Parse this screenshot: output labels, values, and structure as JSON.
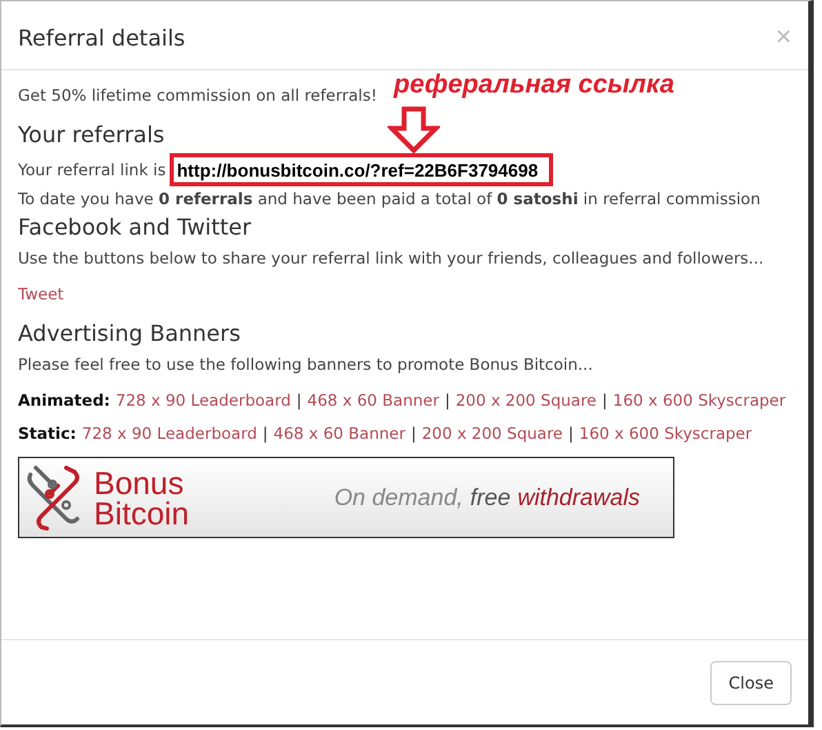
{
  "modal": {
    "title": "Referral details",
    "close_icon": "×"
  },
  "intro": "Get 50% lifetime commission on all referrals!",
  "annotation": {
    "caption": "реферальная ссылка"
  },
  "referrals": {
    "heading": "Your referrals",
    "link_label": "Your referral link is",
    "link": "http://bonusbitcoin.co/?ref=22B6F3794698",
    "summary": "To date you have **0 referrals** and have been paid a total of **0 satoshi** in referral commission"
  },
  "social": {
    "heading": "Facebook and Twitter",
    "text": "Use the buttons below to share your referral link with your friends, colleagues and followers...",
    "tweet": "Tweet"
  },
  "banners": {
    "heading": "Advertising Banners",
    "text": "Please feel free to use the following banners to promote Bonus Bitcoin...",
    "rows": [
      {
        "label": "Animated:",
        "links": [
          "728 x 90 Leaderboard",
          "468 x 60 Banner",
          "200 x 200 Square",
          "160 x 600 Skyscraper"
        ],
        "separator": "|"
      },
      {
        "label": "Static:",
        "links": [
          "728 x 90 Leaderboard",
          "468 x 60 Banner",
          "200 x 200 Square",
          "160 x 600 Skyscraper"
        ],
        "separator": "|"
      }
    ],
    "banner": {
      "brand": [
        "Bonus",
        "Bitcoin"
      ],
      "tagline": [
        {
          "text": "On demand,",
          "kind": "muted"
        },
        {
          "text": "free",
          "kind": "strong"
        },
        {
          "text": "withdrawals",
          "kind": "accent"
        }
      ]
    }
  },
  "footer": {
    "button": "Close"
  }
}
